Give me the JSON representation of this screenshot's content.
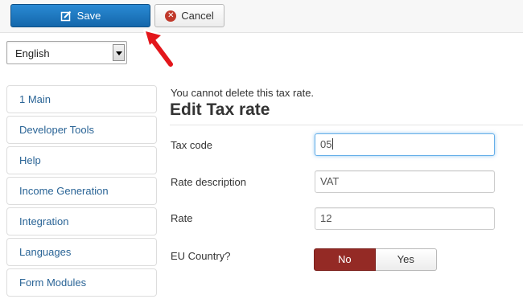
{
  "toolbar": {
    "save_label": "Save",
    "cancel_label": "Cancel",
    "save_icon": "edit-icon",
    "cancel_icon": "cancel-circle-icon"
  },
  "language_select": {
    "value": "English"
  },
  "sidebar": {
    "items": [
      {
        "label": "1 Main"
      },
      {
        "label": "Developer Tools"
      },
      {
        "label": "Help"
      },
      {
        "label": "Income Generation"
      },
      {
        "label": "Integration"
      },
      {
        "label": "Languages"
      },
      {
        "label": "Form Modules"
      }
    ]
  },
  "main": {
    "notice": "You cannot delete this tax rate.",
    "title": "Edit Tax rate",
    "fields": {
      "tax_code": {
        "label": "Tax code",
        "value": "05"
      },
      "rate_description": {
        "label": "Rate description",
        "value": "VAT"
      },
      "rate": {
        "label": "Rate",
        "value": "12"
      },
      "eu_country": {
        "label": "EU Country?",
        "options": [
          "No",
          "Yes"
        ],
        "selected": "No"
      }
    }
  },
  "colors": {
    "save_button": "#1467ab",
    "toggle_selected": "#942a25",
    "link": "#2a6496",
    "arrow": "#e3161b"
  }
}
